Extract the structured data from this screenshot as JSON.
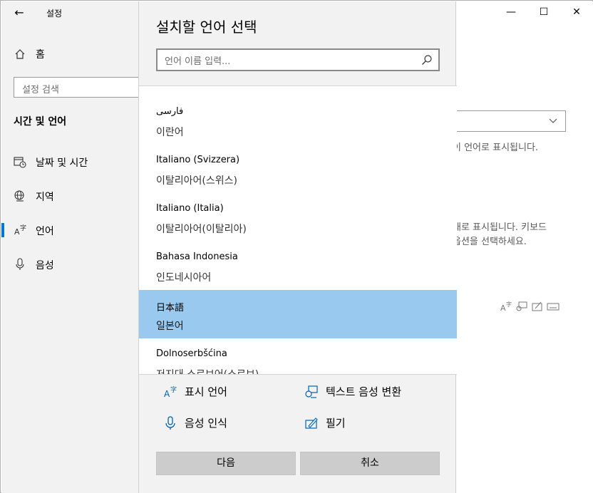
{
  "window": {
    "app_title": "설정",
    "controls": {
      "minimize": "—",
      "maximize": "☐",
      "close": "✕"
    }
  },
  "sidebar": {
    "home_label": "홈",
    "search_placeholder": "설정 검색",
    "section_title": "시간 및 언어",
    "items": [
      {
        "label": "날짜 및 시간",
        "icon": "clock-calendar-icon",
        "active": false
      },
      {
        "label": "지역",
        "icon": "globe-icon",
        "active": false
      },
      {
        "label": "언어",
        "icon": "language-icon",
        "active": true
      },
      {
        "label": "음성",
        "icon": "microphone-icon",
        "active": false
      }
    ]
  },
  "background": {
    "text1": "이 언어로 표시됩니다.",
    "text2": "새로 표시됩니다. 키보드",
    "text3": "옵션을 선택하세요."
  },
  "dialog": {
    "title": "설치할 언어 선택",
    "search_placeholder": "언어 이름 입력...",
    "languages": [
      {
        "native": "فارسی",
        "local": "이란어",
        "selected": false
      },
      {
        "native": "Italiano (Svizzera)",
        "local": "이탈리아어(스위스)",
        "selected": false
      },
      {
        "native": "Italiano (Italia)",
        "local": "이탈리아어(이탈리아)",
        "selected": false
      },
      {
        "native": "Bahasa Indonesia",
        "local": "인도네시아어",
        "selected": false
      },
      {
        "native": "日本語",
        "local": "일본어",
        "selected": true
      },
      {
        "native": "Dolnoserbšćina",
        "local": "저지대 소르브어(소르브)",
        "selected": false
      }
    ],
    "features": {
      "display_language": "표시 언어",
      "text_to_speech": "텍스트 음성 변환",
      "speech_recognition": "음성 인식",
      "handwriting": "필기"
    },
    "next_label": "다음",
    "cancel_label": "취소"
  },
  "colors": {
    "accent": "#0078d4",
    "selected_row": "#99c9ef",
    "button": "#cccccc"
  }
}
